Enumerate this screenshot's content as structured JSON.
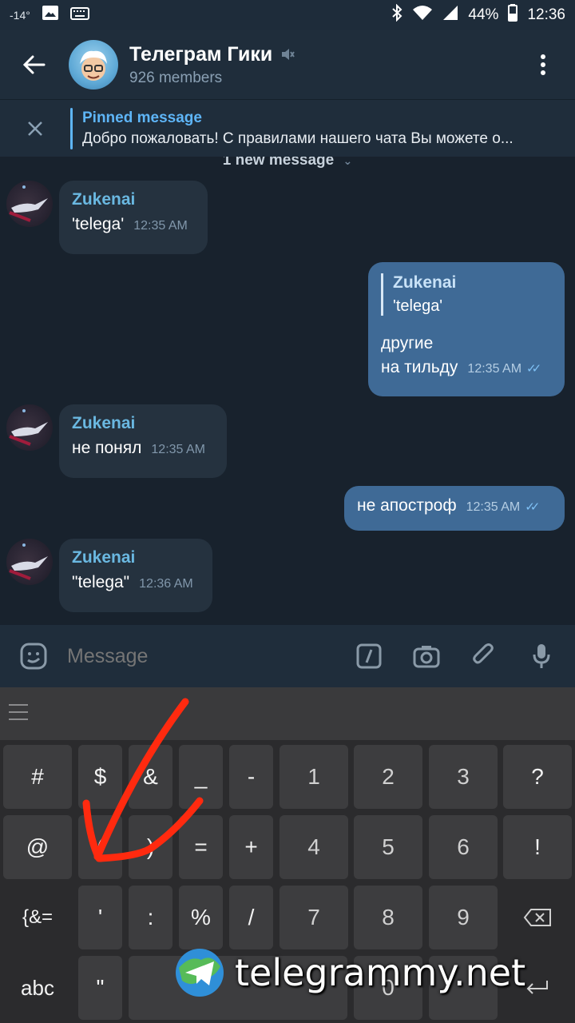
{
  "status_bar": {
    "temp": "-14°",
    "battery": "44%",
    "time": "12:36"
  },
  "header": {
    "title": "Телеграм Гики",
    "subtitle": "926 members"
  },
  "pinned": {
    "title": "Pinned message",
    "text": "Добро пожаловать! С правилами нашего чата Вы можете о..."
  },
  "chat": {
    "new_message_label": "1 new message",
    "messages": [
      {
        "sender": "Zukenai",
        "text": "'telega'",
        "time": "12:35 AM"
      },
      {
        "reply_name": "Zukenai",
        "reply_text": "'telega'",
        "line1": "другие",
        "line2": "на тильду",
        "time": "12:35 AM"
      },
      {
        "sender": "Zukenai",
        "text": "не понял",
        "time": "12:35 AM"
      },
      {
        "text": "не апостроф",
        "time": "12:35 AM"
      },
      {
        "sender": "Zukenai",
        "text": "\"telega\"",
        "time": "12:36 AM"
      }
    ]
  },
  "input": {
    "placeholder": "Message"
  },
  "keyboard": {
    "row1": [
      "#",
      "$",
      "&",
      "_",
      "-",
      "1",
      "2",
      "3",
      "?"
    ],
    "row2": [
      "@",
      "(",
      ")",
      "=",
      "+",
      "4",
      "5",
      "6",
      "!"
    ],
    "row3": [
      "{&=",
      "'",
      ":",
      "%",
      "/",
      "7",
      "8",
      "9"
    ],
    "row4": [
      "abc",
      "\"",
      "0"
    ]
  },
  "watermark": "telegrammy.net",
  "colors": {
    "accent": "#5eb5f7",
    "outgoing_bubble": "#3f6a96",
    "incoming_bubble": "#25323f",
    "arrow": "#ff2a0f"
  }
}
